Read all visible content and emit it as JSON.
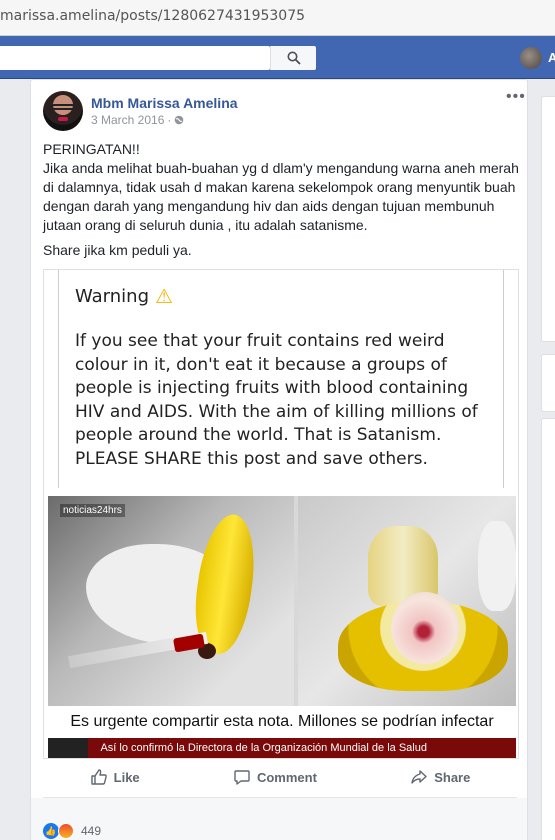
{
  "browser": {
    "url": "marissa.amelina/posts/1280627431953075"
  },
  "topbar": {
    "user_initial": "A"
  },
  "post": {
    "author": "Mbm Marissa Amelina",
    "date": "3 March 2016",
    "privacy_sep": "·",
    "text_heading": "PERINGATAN!!",
    "text_body": "Jika anda melihat buah-buahan yg d dlam'y mengandung warna aneh merah di dalamnya, tidak usah d makan karena sekelompok orang menyuntik buah dengan darah yang mengandung hiv dan aids dengan tujuan membunuh jutaan orang di seluruh dunia , itu adalah satanisme.",
    "text_footer": "Share jika km peduli ya."
  },
  "shared_image": {
    "warning_title": "Warning",
    "warning_body": "If you see that your fruit contains red weird colour in it, don't eat it because a groups of people is injecting fruits with blood containing HIV and AIDS. With the aim of killing millions of people around the world. That is Satanism. PLEASE SHARE this post and save others.",
    "channel_logo": "noticias24hrs",
    "caption": "Es urgente compartir esta nota. Millones se podrían infectar",
    "ticker": "Así lo confirmó la Directora de la Organización Mundial de la Salud"
  },
  "actions": {
    "like": "Like",
    "comment": "Comment",
    "share": "Share"
  },
  "reactions": {
    "count": "449"
  },
  "colors": {
    "fb_blue": "#4267b2",
    "link": "#365899",
    "like_blue": "#1877f2"
  },
  "icons": [
    "search-icon",
    "globe-icon",
    "more-icon",
    "warning-icon",
    "like-icon",
    "comment-icon",
    "share-icon"
  ]
}
